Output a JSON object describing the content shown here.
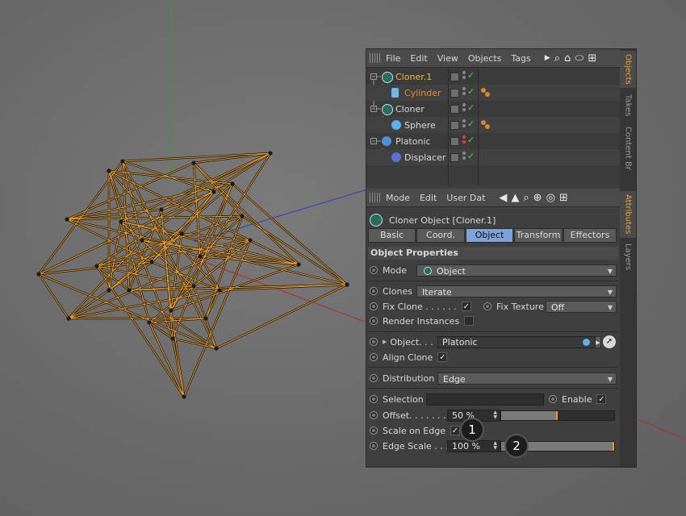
{
  "object_manager": {
    "menu": [
      "File",
      "Edit",
      "View",
      "Objects",
      "Tags"
    ],
    "objects": [
      {
        "name": "Cloner.1",
        "color": "#f0b93a",
        "icon": "cloner-icon"
      },
      {
        "name": "Cylinder",
        "color": "#e0902a",
        "icon": "cylinder-icon"
      },
      {
        "name": "Cloner",
        "color": "#d8d8d8",
        "icon": "cloner-icon"
      },
      {
        "name": "Sphere",
        "color": "#d8d8d8",
        "icon": "sphere-icon"
      },
      {
        "name": "Platonic",
        "color": "#d8d8d8",
        "icon": "platonic-icon"
      },
      {
        "name": "Displacer",
        "color": "#d8d8d8",
        "icon": "displacer-icon"
      }
    ]
  },
  "side_tabs": {
    "objects": "Objects",
    "takes": "Takes",
    "content": "Content Br",
    "attributes": "Attributes",
    "layers": "Layers"
  },
  "attributes": {
    "menu": [
      "Mode",
      "Edit",
      "User Dat"
    ],
    "title": "Cloner Object [Cloner.1]",
    "tabs": [
      "Basic",
      "Coord.",
      "Object",
      "Transform",
      "Effectors"
    ],
    "active_tab": "Object",
    "section": "Object Properties",
    "mode_label": "Mode",
    "mode_value": "Object",
    "clones_label": "Clones",
    "clones_value": "Iterate",
    "fix_clone_label": "Fix Clone . . . . . .",
    "fix_texture_label": "Fix Texture",
    "fix_texture_value": "Off",
    "render_instances_label": "Render Instances",
    "object_label": "Object. . .",
    "object_value": "Platonic",
    "align_clone_label": "Align Clone",
    "distribution_label": "Distribution",
    "distribution_value": "Edge",
    "selection_label": "Selection",
    "enable_label": "Enable",
    "offset_label": "Offset. . . . . . . .",
    "offset_value": "50 %",
    "offset_fraction": 0.5,
    "scale_on_edge_label": "Scale on Edge",
    "edge_scale_label": "Edge Scale . . .",
    "edge_scale_value": "100 %",
    "edge_scale_fraction": 1.0
  },
  "callouts": [
    "1",
    "2"
  ]
}
